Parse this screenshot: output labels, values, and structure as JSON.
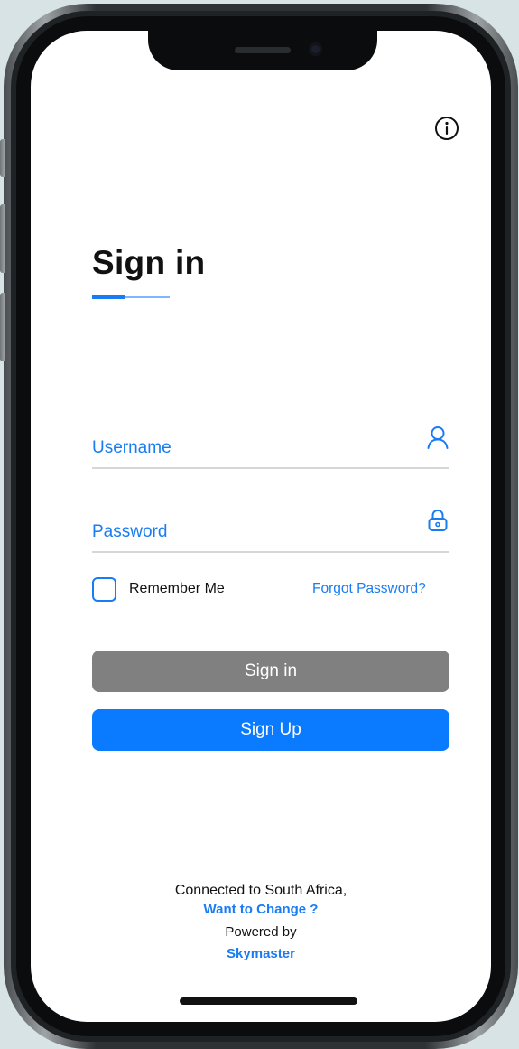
{
  "colors": {
    "accent": "#1a7cf2",
    "signin_button": "#808080",
    "signup_button": "#0a7aff",
    "title_text": "#111111",
    "background": "#ffffff"
  },
  "header": {
    "info_icon": "info-icon"
  },
  "title": {
    "text": "Sign in"
  },
  "form": {
    "username": {
      "placeholder": "Username",
      "value": "",
      "icon": "user-icon"
    },
    "password": {
      "placeholder": "Password",
      "value": "",
      "icon": "lock-icon"
    },
    "remember_me": {
      "label": "Remember Me",
      "checked": false
    },
    "forgot_password": "Forgot Password?"
  },
  "buttons": {
    "sign_in": "Sign in",
    "sign_up": "Sign Up"
  },
  "footer": {
    "connected": "Connected to South Africa,",
    "change_link": "Want to Change ?",
    "powered_by": "Powered by",
    "brand": "Skymaster"
  }
}
